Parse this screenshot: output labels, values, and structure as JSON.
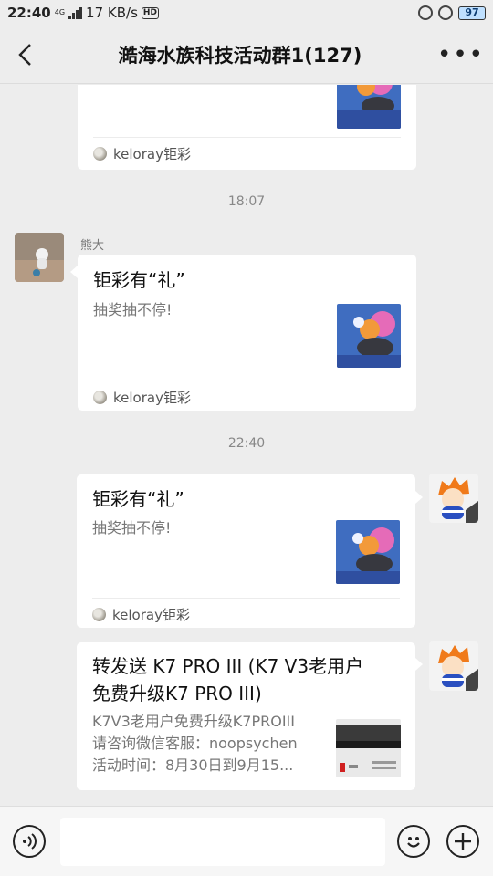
{
  "status_bar": {
    "time": "22:40",
    "network_type": "4G",
    "speed": "17 KB/s",
    "hd_label": "HD",
    "battery": "97"
  },
  "header": {
    "title": "澔海水族科技活动群1(127)",
    "back_icon": "chevron-left-icon",
    "more_icon": "more-dots-icon"
  },
  "messages": [
    {
      "type": "link_card",
      "direction": "incoming",
      "partial": true,
      "source": "keloray钜彩"
    },
    {
      "type": "timestamp",
      "text": "18:07"
    },
    {
      "type": "link_card",
      "direction": "incoming",
      "sender": "熊大",
      "title": "钜彩有“礼”",
      "desc": "抽奖抽不停!",
      "source": "keloray钜彩"
    },
    {
      "type": "timestamp",
      "text": "22:40"
    },
    {
      "type": "link_card",
      "direction": "outgoing",
      "title": "钜彩有“礼”",
      "desc": "抽奖抽不停!",
      "source": "keloray钜彩"
    },
    {
      "type": "link_card",
      "direction": "outgoing",
      "title_line1": "转发送 K7 PRO III (K7 V3老用户",
      "title_line2": "免费升级K7 PRO III)",
      "desc_line1": "K7V3老用户免费升级K7PROIII",
      "desc_line2": "请咨询微信客服：noopsychen",
      "desc_line3": "活动时间：8月30日到9月15..."
    }
  ],
  "input_bar": {
    "voice_icon": "voice-icon",
    "emoji_icon": "emoji-icon",
    "plus_icon": "plus-icon",
    "placeholder": ""
  },
  "colors": {
    "background": "#ededed",
    "bubble": "#ffffff",
    "battery_fill": "#bfe0ff"
  }
}
